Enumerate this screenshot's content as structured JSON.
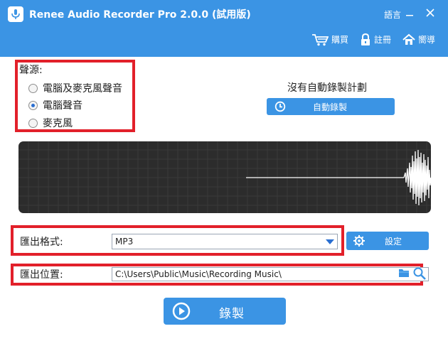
{
  "window": {
    "title": "Renee Audio Recorder Pro 2.0.0 (試用版)",
    "language_label": "語言",
    "actions": [
      {
        "label": "購買",
        "icon": "cart-icon"
      },
      {
        "label": "註冊",
        "icon": "lock-icon"
      },
      {
        "label": "嚮導",
        "icon": "home-icon"
      }
    ]
  },
  "source": {
    "title": "聲源:",
    "options": [
      {
        "label": "電腦及麥克風聲音",
        "selected": false
      },
      {
        "label": "電腦聲音",
        "selected": true
      },
      {
        "label": "麥克風",
        "selected": false
      }
    ]
  },
  "schedule": {
    "status_text": "沒有自動錄製計劃",
    "button_label": "自動錄製"
  },
  "output": {
    "format_label": "匯出格式:",
    "format_value": "MP3",
    "settings_label": "設定",
    "location_label": "匯出位置:",
    "location_value": "C:\\Users\\Public\\Music\\Recording Music\\"
  },
  "record": {
    "label": "錄製"
  },
  "colors": {
    "accent": "#3b94e4",
    "highlight_box": "#e2202a",
    "waveform_bg": "#2c2c2c",
    "waveform_line": "#ffffff"
  }
}
